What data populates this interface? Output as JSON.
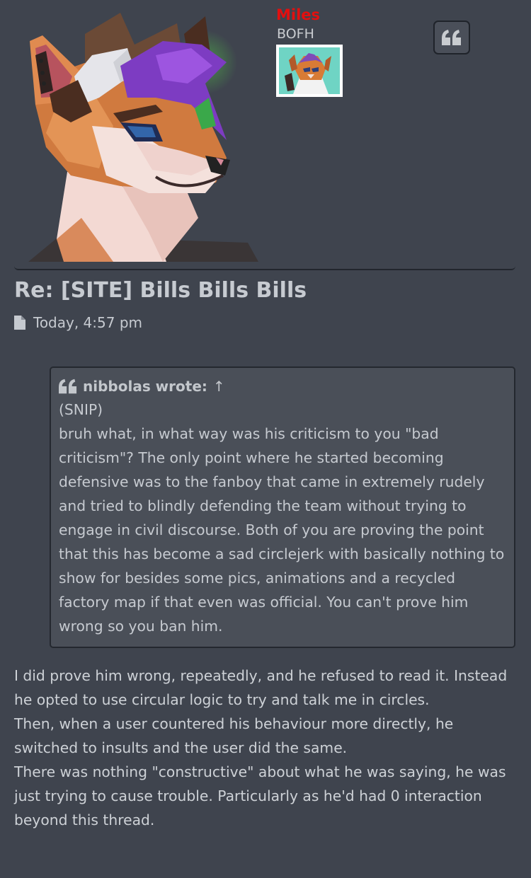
{
  "author": {
    "username": "Miles",
    "username_color": "#e30f0f",
    "rank": "BOFH"
  },
  "icons": {
    "quote_button": "quote-icon",
    "post_meta": "file-icon",
    "cite": "quote-icon"
  },
  "post": {
    "title": "Re: [SITE] Bills Bills Bills",
    "timestamp": "Today, 4:57 pm"
  },
  "quote": {
    "author": "nibbolas wrote:",
    "arrow": "↑",
    "lines": [
      "(SNIP)",
      "bruh what, in what way was his criticism to you \"bad criticism\"? The only point where he started becoming defensive was to the fanboy that came in extremely rudely and tried to blindly defending the team without trying to engage in civil discourse. Both of you are proving the point that this has become a sad circlejerk with basically nothing to show for besides some pics, animations and a recycled factory map if that even was official. You can't prove him wrong so you ban him."
    ]
  },
  "reply": {
    "paragraphs": [
      "I did prove him wrong, repeatedly, and he refused to read it. Instead he opted to use circular logic to try and talk me in circles.",
      "Then, when a user countered his behaviour more directly, he switched to insults and the user did the same.",
      "There was nothing \"constructive\" about what he was saying, he was just trying to cause trouble. Particularly as he'd had 0 interaction beyond this thread."
    ]
  }
}
